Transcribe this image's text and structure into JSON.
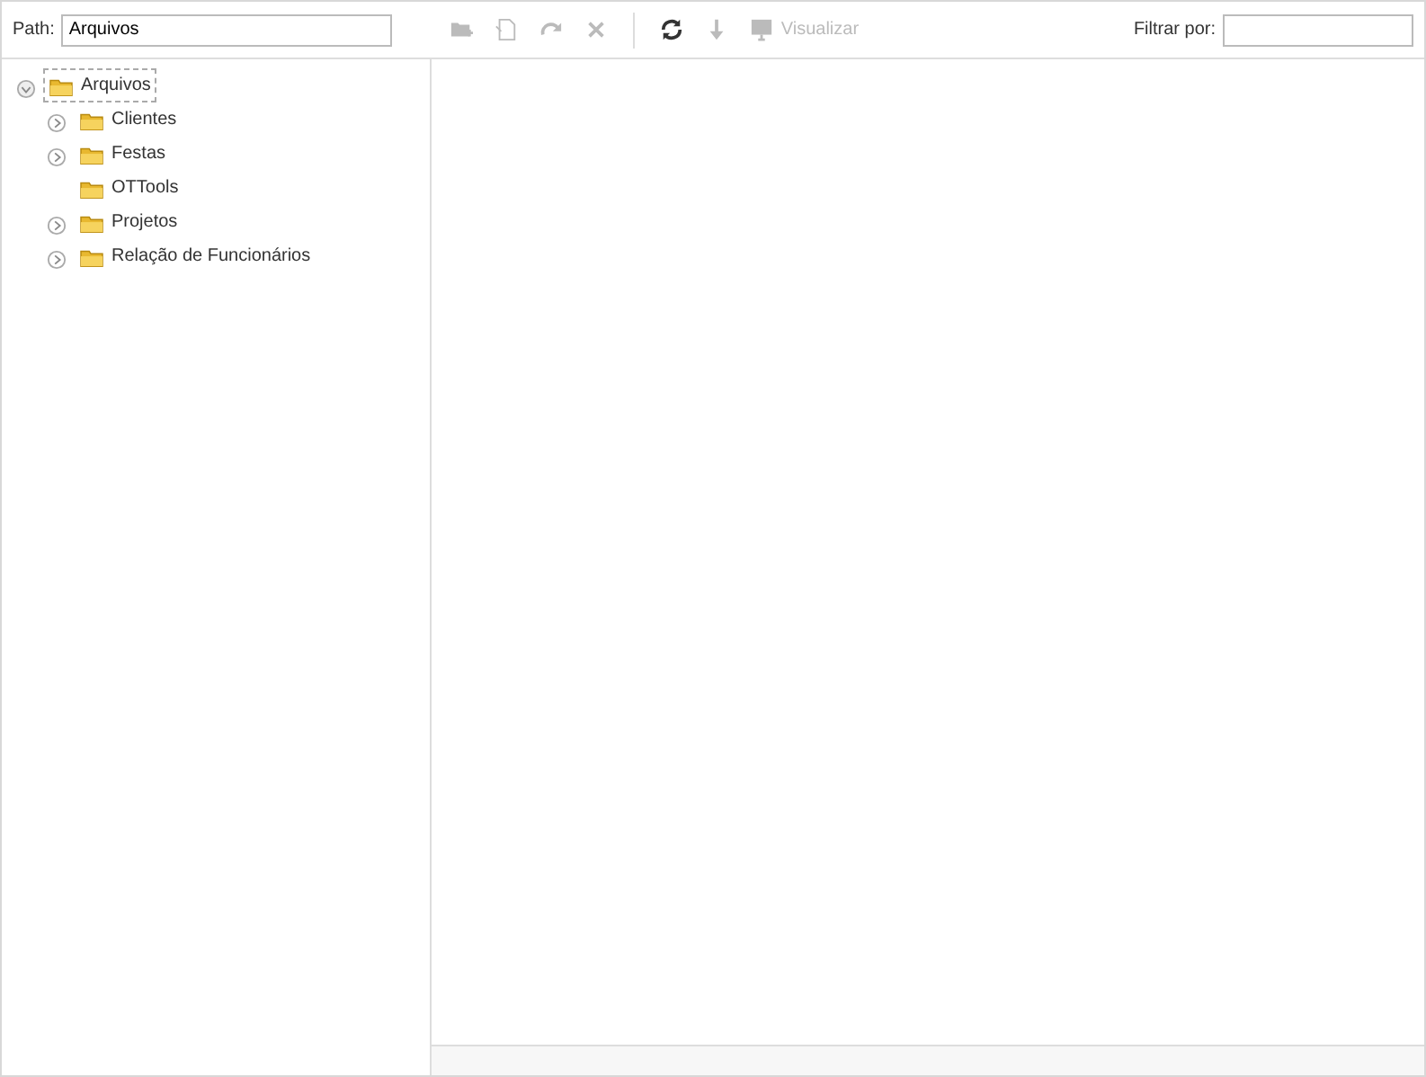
{
  "toolbar": {
    "path_label": "Path:",
    "path_value": "Arquivos",
    "tools": [
      {
        "kind": "new-folder",
        "disabled": true
      },
      {
        "kind": "rename",
        "disabled": true
      },
      {
        "kind": "redo",
        "disabled": true
      },
      {
        "kind": "delete",
        "disabled": true
      },
      {
        "kind": "separator"
      },
      {
        "kind": "refresh",
        "disabled": false
      },
      {
        "kind": "download",
        "disabled": true
      },
      {
        "kind": "preview",
        "disabled": true,
        "label": "Visualizar"
      }
    ],
    "filter_label": "Filtrar por:"
  },
  "tree": [
    {
      "label": "Arquivos",
      "expanded": true,
      "selected": true,
      "children": [
        {
          "label": "Clientes",
          "expanded": false,
          "selected": false,
          "has_children": true
        },
        {
          "label": "Festas",
          "expanded": false,
          "selected": false,
          "has_children": true
        },
        {
          "label": "OTTools",
          "selected": false,
          "has_children": false
        },
        {
          "label": "Projetos",
          "expanded": false,
          "selected": false,
          "has_children": true
        },
        {
          "label": "Relação de Funcionários",
          "expanded": false,
          "selected": false,
          "has_children": true
        }
      ]
    }
  ]
}
